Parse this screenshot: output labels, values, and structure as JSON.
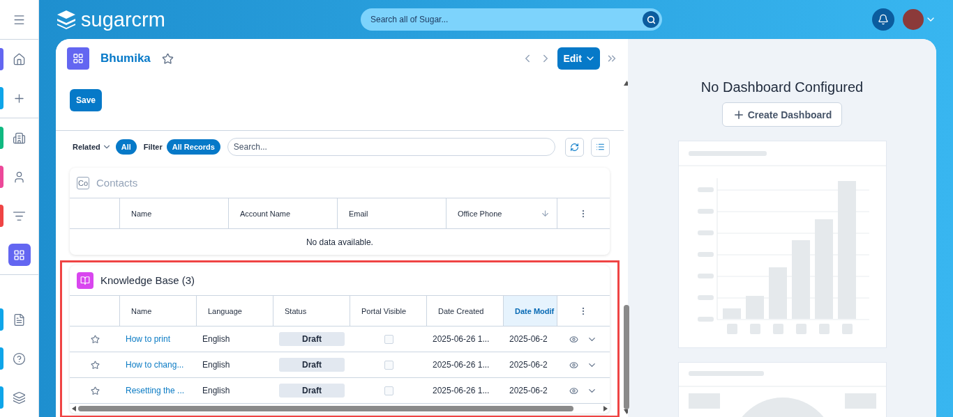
{
  "sidebar": {
    "sections": [
      {
        "items": [
          {
            "kind": "menu",
            "selected": false
          }
        ]
      },
      {
        "items": [
          {
            "kind": "home",
            "color": "#6366f1",
            "selected": false
          },
          {
            "kind": "create",
            "color": "#0ea5e9",
            "selected": false
          }
        ]
      },
      {
        "items": [
          {
            "kind": "accounts",
            "color": "#10b981",
            "selected": false
          },
          {
            "kind": "contacts",
            "color": "#ec4899",
            "selected": false
          },
          {
            "kind": "leads",
            "color": "#ef4444",
            "selected": false
          },
          {
            "kind": "dashboard",
            "color": "#6366f1",
            "selected": true
          }
        ]
      },
      {
        "items": [
          {
            "kind": "documents",
            "color": "#0ea5e9",
            "selected": false
          },
          {
            "kind": "help",
            "color": "#0ea5e9",
            "selected": false
          },
          {
            "kind": "layers",
            "color": "#0ea5e9",
            "selected": false
          }
        ]
      }
    ]
  },
  "header": {
    "logo": "**sugar**crm",
    "search": {
      "placeholder": "Search all of Sugar..."
    }
  },
  "record": {
    "name": "Bhumika",
    "favorite": false,
    "edit_button": "Edit",
    "save_button": "Save"
  },
  "subpanel_toolbar": {
    "related_label": "Related",
    "related_value": "All",
    "filter_label": "Filter",
    "filter_value": "All Records",
    "search_placeholder": "Search..."
  },
  "subpanels": [
    {
      "kind": "contacts",
      "icon_text": "Co",
      "title": "Contacts",
      "highlighted": false,
      "columns": [
        {
          "label": "Name",
          "sorted": false,
          "selected": false
        },
        {
          "label": "Account Name",
          "sorted": false,
          "selected": false
        },
        {
          "label": "Email",
          "sorted": false,
          "selected": false
        },
        {
          "label": "Office Phone",
          "sorted": true,
          "selected": false
        }
      ],
      "empty_text": "No data available."
    },
    {
      "kind": "knowledge_base",
      "title": "Knowledge Base (3)",
      "highlighted": true,
      "columns": [
        {
          "label": "Name",
          "sorted": false,
          "selected": false
        },
        {
          "label": "Language",
          "sorted": false,
          "selected": false
        },
        {
          "label": "Status",
          "sorted": false,
          "selected": false
        },
        {
          "label": "Portal Visible",
          "sorted": false,
          "selected": false
        },
        {
          "label": "Date Created",
          "sorted": false,
          "selected": false
        },
        {
          "label": "Date Modif",
          "sorted": false,
          "selected": true
        }
      ],
      "rows": [
        {
          "favorite": false,
          "name": "How to print",
          "language": "English",
          "status": "Draft",
          "portal_visible": false,
          "date_created": "2025-06-26 1...",
          "date_modified": "2025-06-2"
        },
        {
          "favorite": false,
          "name": "How to chang...",
          "language": "English",
          "status": "Draft",
          "portal_visible": false,
          "date_created": "2025-06-26 1...",
          "date_modified": "2025-06-2"
        },
        {
          "favorite": false,
          "name": "Resetting the ...",
          "language": "English",
          "status": "Draft",
          "portal_visible": false,
          "date_created": "2025-06-26 1...",
          "date_modified": "2025-06-2"
        }
      ]
    }
  ],
  "dashboard": {
    "title": "No Dashboard Configured",
    "button": "Create Dashboard"
  }
}
